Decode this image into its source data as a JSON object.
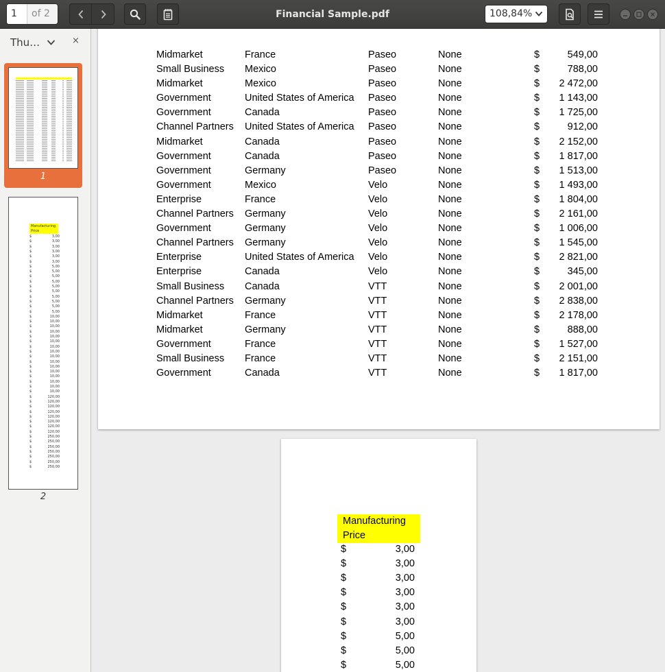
{
  "toolbar": {
    "page_current": "1",
    "page_total": "of 2",
    "title": "Financial Sample.pdf",
    "zoom": "108,84%"
  },
  "sidebar": {
    "view_label": "Thu…",
    "close": "×",
    "thumbs": [
      {
        "label": "1"
      },
      {
        "label": "2"
      }
    ]
  },
  "page1": {
    "partial_row": {
      "segment": "Midmarket",
      "country": "France",
      "product": "Paseo",
      "discount": "None",
      "currency": "$",
      "amount": "549,00"
    },
    "rows": [
      {
        "segment": "Small Business",
        "country": "Mexico",
        "product": "Paseo",
        "discount": "None",
        "currency": "$",
        "amount": "788,00"
      },
      {
        "segment": "Midmarket",
        "country": "Mexico",
        "product": "Paseo",
        "discount": "None",
        "currency": "$",
        "amount": "2 472,00"
      },
      {
        "segment": "Government",
        "country": "United States of America",
        "product": "Paseo",
        "discount": "None",
        "currency": "$",
        "amount": "1 143,00"
      },
      {
        "segment": "Government",
        "country": "Canada",
        "product": "Paseo",
        "discount": "None",
        "currency": "$",
        "amount": "1 725,00"
      },
      {
        "segment": "Channel Partners",
        "country": "United States of America",
        "product": "Paseo",
        "discount": "None",
        "currency": "$",
        "amount": "912,00"
      },
      {
        "segment": "Midmarket",
        "country": "Canada",
        "product": "Paseo",
        "discount": "None",
        "currency": "$",
        "amount": "2 152,00"
      },
      {
        "segment": "Government",
        "country": "Canada",
        "product": "Paseo",
        "discount": "None",
        "currency": "$",
        "amount": "1 817,00"
      },
      {
        "segment": "Government",
        "country": "Germany",
        "product": "Paseo",
        "discount": "None",
        "currency": "$",
        "amount": "1 513,00"
      },
      {
        "segment": "Government",
        "country": "Mexico",
        "product": "Velo",
        "discount": "None",
        "currency": "$",
        "amount": "1 493,00"
      },
      {
        "segment": "Enterprise",
        "country": "France",
        "product": "Velo",
        "discount": "None",
        "currency": "$",
        "amount": "1 804,00"
      },
      {
        "segment": "Channel Partners",
        "country": "Germany",
        "product": "Velo",
        "discount": "None",
        "currency": "$",
        "amount": "2 161,00"
      },
      {
        "segment": "Government",
        "country": "Germany",
        "product": "Velo",
        "discount": "None",
        "currency": "$",
        "amount": "1 006,00"
      },
      {
        "segment": "Channel Partners",
        "country": "Germany",
        "product": "Velo",
        "discount": "None",
        "currency": "$",
        "amount": "1 545,00"
      },
      {
        "segment": "Enterprise",
        "country": "United States of America",
        "product": "Velo",
        "discount": "None",
        "currency": "$",
        "amount": "2 821,00"
      },
      {
        "segment": "Enterprise",
        "country": "Canada",
        "product": "Velo",
        "discount": "None",
        "currency": "$",
        "amount": "345,00"
      },
      {
        "segment": "Small Business",
        "country": "Canada",
        "product": "VTT",
        "discount": "None",
        "currency": "$",
        "amount": "2 001,00"
      },
      {
        "segment": "Channel Partners",
        "country": "Germany",
        "product": "VTT",
        "discount": "None",
        "currency": "$",
        "amount": "2 838,00"
      },
      {
        "segment": "Midmarket",
        "country": "France",
        "product": "VTT",
        "discount": "None",
        "currency": "$",
        "amount": "2 178,00"
      },
      {
        "segment": "Midmarket",
        "country": "Germany",
        "product": "VTT",
        "discount": "None",
        "currency": "$",
        "amount": "888,00"
      },
      {
        "segment": "Government",
        "country": "France",
        "product": "VTT",
        "discount": "None",
        "currency": "$",
        "amount": "1 527,00"
      },
      {
        "segment": "Small Business",
        "country": "France",
        "product": "VTT",
        "discount": "None",
        "currency": "$",
        "amount": "2 151,00"
      },
      {
        "segment": "Government",
        "country": "Canada",
        "product": "VTT",
        "discount": "None",
        "currency": "$",
        "amount": "1 817,00"
      }
    ]
  },
  "page2": {
    "header_line1": "Manufacturing",
    "header_line2": "Price",
    "rows": [
      {
        "currency": "$",
        "value": "3,00"
      },
      {
        "currency": "$",
        "value": "3,00"
      },
      {
        "currency": "$",
        "value": "3,00"
      },
      {
        "currency": "$",
        "value": "3,00"
      },
      {
        "currency": "$",
        "value": "3,00"
      },
      {
        "currency": "$",
        "value": "3,00"
      },
      {
        "currency": "$",
        "value": "5,00"
      },
      {
        "currency": "$",
        "value": "5,00"
      },
      {
        "currency": "$",
        "value": "5,00"
      }
    ]
  },
  "thumb2": {
    "header_line1": "Manufacturing",
    "header_line2": "Price",
    "values": [
      "3,00",
      "3,00",
      "3,00",
      "3,00",
      "3,00",
      "3,00",
      "5,00",
      "5,00",
      "5,00",
      "5,00",
      "5,00",
      "5,00",
      "5,00",
      "5,00",
      "5,00",
      "5,00",
      "10,00",
      "10,00",
      "10,00",
      "10,00",
      "10,00",
      "10,00",
      "10,00",
      "10,00",
      "10,00",
      "10,00",
      "10,00",
      "10,00",
      "10,00",
      "10,00",
      "10,00",
      "10,00",
      "120,00",
      "120,00",
      "120,00",
      "120,00",
      "120,00",
      "120,00",
      "120,00",
      "120,00",
      "250,00",
      "250,00",
      "250,00",
      "250,00",
      "250,00",
      "250,00",
      "250,00"
    ]
  },
  "colors": {
    "accent": "#e8703c",
    "highlight": "#ffff00",
    "headerbar": "#3c3c3a"
  }
}
